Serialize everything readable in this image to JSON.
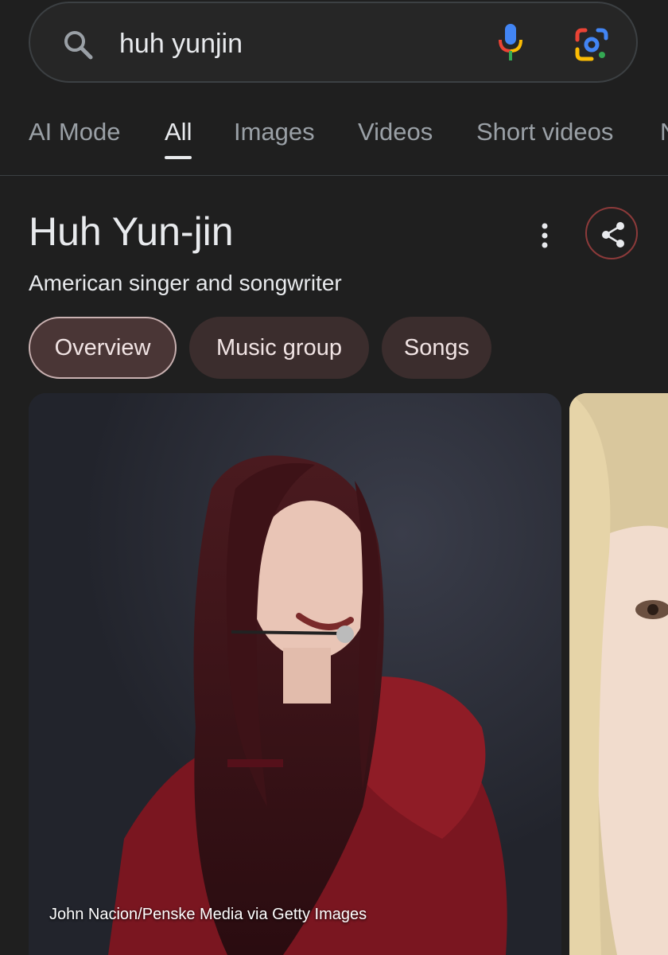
{
  "search": {
    "query": "huh yunjin",
    "icon": "search-icon",
    "mic_icon": "microphone-icon",
    "lens_icon": "lens-camera-icon"
  },
  "tabs": [
    {
      "label": "AI Mode",
      "active": false
    },
    {
      "label": "All",
      "active": true
    },
    {
      "label": "Images",
      "active": false
    },
    {
      "label": "Videos",
      "active": false
    },
    {
      "label": "Short videos",
      "active": false
    },
    {
      "label": "N",
      "active": false
    }
  ],
  "knowledge_panel": {
    "title": "Huh Yun-jin",
    "subtitle": "American singer and songwriter",
    "chips": [
      {
        "label": "Overview",
        "selected": true
      },
      {
        "label": "Music group",
        "selected": false
      },
      {
        "label": "Songs",
        "selected": false
      }
    ],
    "image_caption": "John Nacion/Penske Media via Getty Images"
  },
  "colors": {
    "background": "#1f1f1f",
    "chip": "#3b2d2d",
    "chip_selected": "#4a3636",
    "share_ring": "#8c3a3a"
  }
}
